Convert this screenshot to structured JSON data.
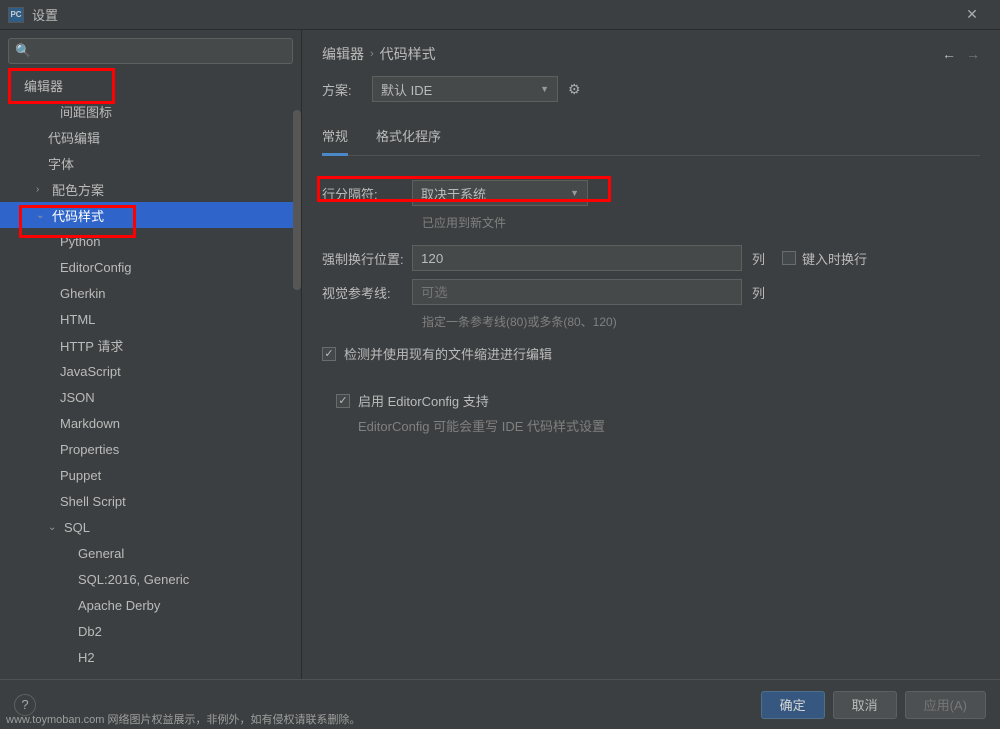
{
  "window": {
    "title": "设置"
  },
  "sidebar": {
    "search_placeholder": "",
    "items": [
      {
        "label": "编辑器",
        "level": 0,
        "expandable": false,
        "indent": 24
      },
      {
        "label": "间距图标",
        "level": 1,
        "indent": 60
      },
      {
        "label": "代码编辑",
        "level": 1,
        "indent": 48
      },
      {
        "label": "字体",
        "level": 1,
        "indent": 48
      },
      {
        "label": "配色方案",
        "level": 1,
        "expandable": true,
        "arrow": "›",
        "indent": 36
      },
      {
        "label": "代码样式",
        "level": 1,
        "expandable": true,
        "arrow": "⌄",
        "selected": true,
        "indent": 36
      },
      {
        "label": "Python",
        "level": 2,
        "indent": 60
      },
      {
        "label": "EditorConfig",
        "level": 2,
        "indent": 60
      },
      {
        "label": "Gherkin",
        "level": 2,
        "indent": 60
      },
      {
        "label": "HTML",
        "level": 2,
        "indent": 60
      },
      {
        "label": "HTTP 请求",
        "level": 2,
        "indent": 60
      },
      {
        "label": "JavaScript",
        "level": 2,
        "indent": 60
      },
      {
        "label": "JSON",
        "level": 2,
        "indent": 60
      },
      {
        "label": "Markdown",
        "level": 2,
        "indent": 60
      },
      {
        "label": "Properties",
        "level": 2,
        "indent": 60
      },
      {
        "label": "Puppet",
        "level": 2,
        "indent": 60
      },
      {
        "label": "Shell Script",
        "level": 2,
        "indent": 60
      },
      {
        "label": "SQL",
        "level": 2,
        "expandable": true,
        "arrow": "⌄",
        "indent": 48
      },
      {
        "label": "General",
        "level": 3,
        "indent": 78
      },
      {
        "label": "SQL:2016, Generic",
        "level": 3,
        "indent": 78
      },
      {
        "label": "Apache Derby",
        "level": 3,
        "indent": 78
      },
      {
        "label": "Db2",
        "level": 3,
        "indent": 78
      },
      {
        "label": "H2",
        "level": 3,
        "indent": 78
      }
    ]
  },
  "content": {
    "breadcrumb": {
      "a": "编辑器",
      "sep": "›",
      "b": "代码样式"
    },
    "scheme": {
      "label": "方案:",
      "value": "默认 IDE"
    },
    "tabs": {
      "general": "常规",
      "formatter": "格式化程序"
    },
    "line_sep": {
      "label": "行分隔符:",
      "value": "取决于系统",
      "help": "已应用到新文件"
    },
    "hard_wrap": {
      "label": "强制换行位置:",
      "value": "120",
      "col": "列",
      "typing": "键入时换行"
    },
    "visual_guide": {
      "label": "视觉参考线:",
      "placeholder": "可选",
      "col": "列",
      "help": "指定一条参考线(80)或多条(80、120)"
    },
    "detect_indent": "检测并使用现有的文件缩进进行编辑",
    "editorconfig": {
      "label": "启用 EditorConfig 支持",
      "note": "EditorConfig 可能会重写 IDE 代码样式设置"
    }
  },
  "footer": {
    "ok": "确定",
    "cancel": "取消",
    "apply": "应用(A)"
  },
  "watermark": "www.toymoban.com 网络图片权益展示，非例外，如有侵权请联系删除。"
}
